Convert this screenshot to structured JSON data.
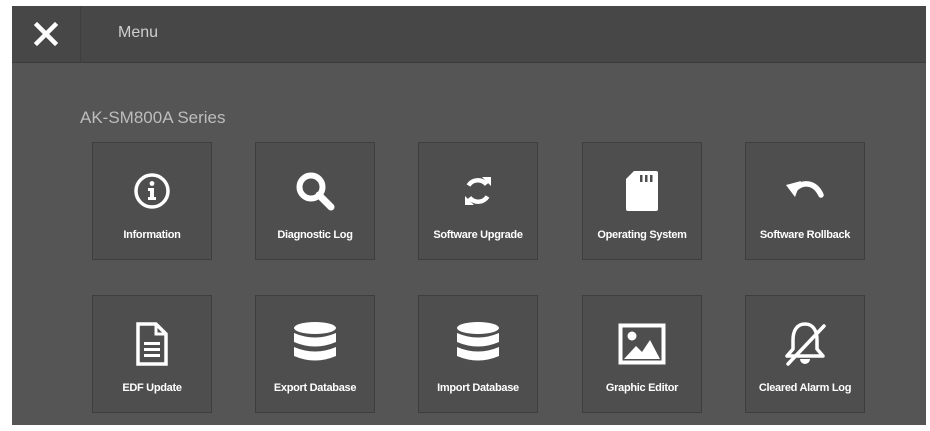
{
  "header": {
    "close_icon": "close-icon",
    "title": "Menu"
  },
  "section": {
    "title": "AK-SM800A Series"
  },
  "tiles": [
    {
      "label": "Information",
      "icon": "info-circle-icon"
    },
    {
      "label": "Diagnostic Log",
      "icon": "search-icon"
    },
    {
      "label": "Software Upgrade",
      "icon": "refresh-icon"
    },
    {
      "label": "Operating System",
      "icon": "sd-card-icon"
    },
    {
      "label": "Software Rollback",
      "icon": "undo-arrow-icon"
    },
    {
      "label": "EDF Update",
      "icon": "document-icon"
    },
    {
      "label": "Export Database",
      "icon": "database-icon"
    },
    {
      "label": "Import Database",
      "icon": "database-icon"
    },
    {
      "label": "Graphic Editor",
      "icon": "image-icon"
    },
    {
      "label": "Cleared Alarm Log",
      "icon": "bell-slash-icon"
    }
  ],
  "colors": {
    "background": "#555555",
    "header": "#474747",
    "tile": "#4e4e4e",
    "icon": "#ffffff"
  }
}
